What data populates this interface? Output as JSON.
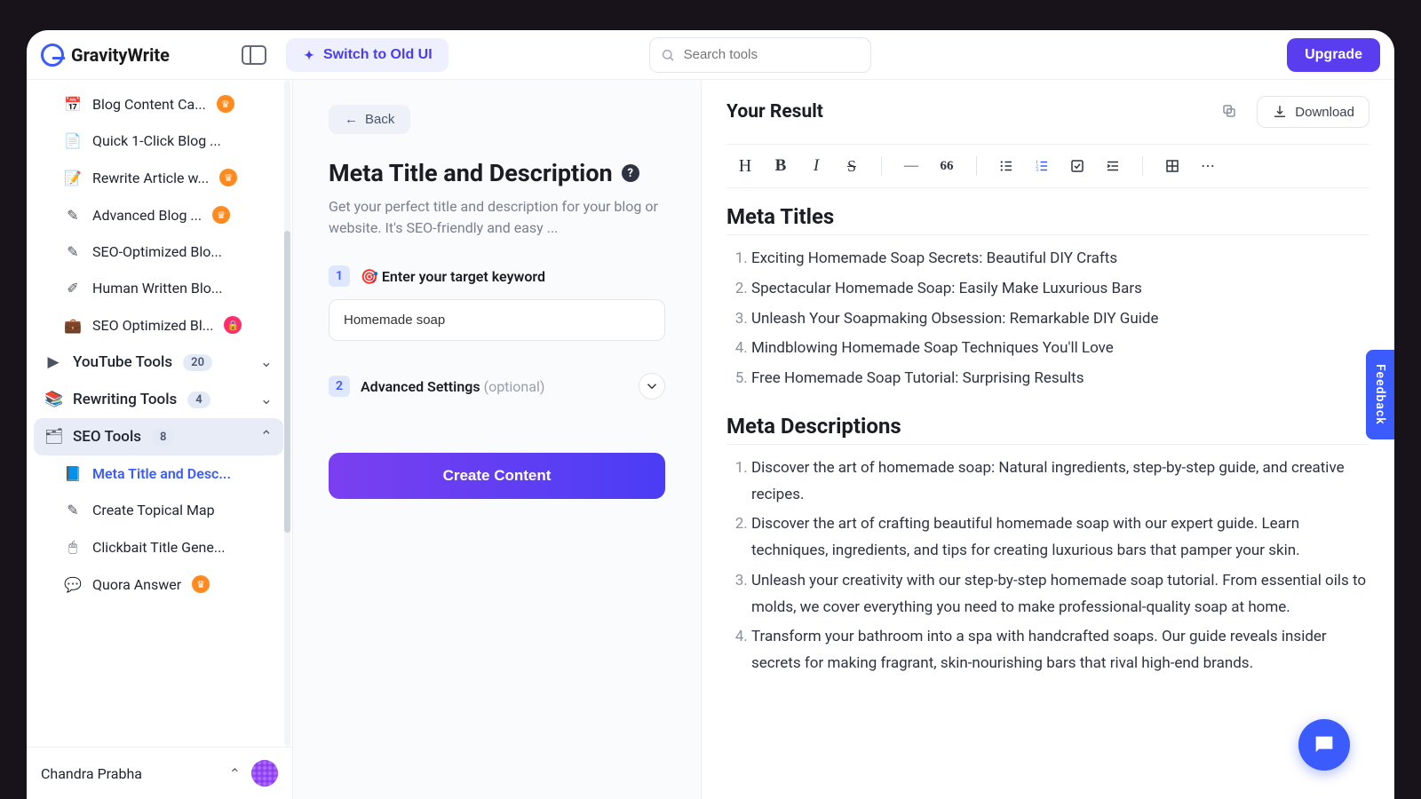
{
  "brand": "GravityWrite",
  "switch_label": "Switch to Old UI",
  "search_placeholder": "Search tools",
  "upgrade_label": "Upgrade",
  "sidebar": {
    "items": [
      {
        "icon": "📅",
        "label": "Blog Content Ca...",
        "badge": "crown"
      },
      {
        "icon": "📄",
        "label": "Quick 1-Click Blog ..."
      },
      {
        "icon": "📝",
        "label": "Rewrite Article w...",
        "badge": "crown"
      },
      {
        "icon": "✎",
        "label": "Advanced Blog ...",
        "badge": "crown"
      },
      {
        "icon": "✎",
        "label": "SEO-Optimized Blo..."
      },
      {
        "icon": "✐",
        "label": "Human Written Blo..."
      },
      {
        "icon": "💼",
        "label": "SEO Optimized Bl...",
        "badge": "lock"
      }
    ],
    "cats": [
      {
        "icon": "▶",
        "label": "YouTube Tools",
        "count": "20",
        "open": false
      },
      {
        "icon": "📚",
        "label": "Rewriting Tools",
        "count": "4",
        "open": false
      },
      {
        "icon": "🗂",
        "label": "SEO Tools",
        "count": "8",
        "open": true,
        "active": true
      }
    ],
    "seo_items": [
      {
        "icon": "📘",
        "label": "Meta Title and Desc...",
        "active": true
      },
      {
        "icon": "✎",
        "label": "Create Topical Map"
      },
      {
        "icon": "🖱",
        "label": "Clickbait Title Gene..."
      },
      {
        "icon": "💬",
        "label": "Quora Answer",
        "badge": "crown"
      }
    ],
    "user": "Chandra Prabha"
  },
  "form": {
    "back": "Back",
    "title": "Meta Title and Description",
    "desc": "Get your perfect title and description for your blog or website. It's SEO-friendly and easy ...",
    "step1": "🎯 Enter your target keyword",
    "keyword": "Homemade soap",
    "step2": "Advanced Settings",
    "optional": "(optional)",
    "create": "Create Content"
  },
  "result": {
    "header": "Your Result",
    "download": "Download",
    "h1": "Meta Titles",
    "titles": [
      "Exciting Homemade Soap Secrets: Beautiful DIY Crafts",
      "Spectacular Homemade Soap: Easily Make Luxurious Bars",
      "Unleash Your Soapmaking Obsession: Remarkable DIY Guide",
      "Mindblowing Homemade Soap Techniques You'll Love",
      "Free Homemade Soap Tutorial: Surprising Results"
    ],
    "h2": "Meta Descriptions",
    "descs": [
      "Discover the art of homemade soap: Natural ingredients, step-by-step guide, and creative recipes.",
      "Discover the art of crafting beautiful homemade soap with our expert guide. Learn techniques, ingredients, and tips for creating luxurious bars that pamper your skin.",
      "Unleash your creativity with our step-by-step homemade soap tutorial. From essential oils to molds, we cover everything you need to make professional-quality soap at home.",
      "Transform your bathroom into a spa with handcrafted soaps. Our guide reveals insider secrets for making fragrant, skin-nourishing bars that rival high-end brands."
    ]
  },
  "feedback": "Feedback"
}
